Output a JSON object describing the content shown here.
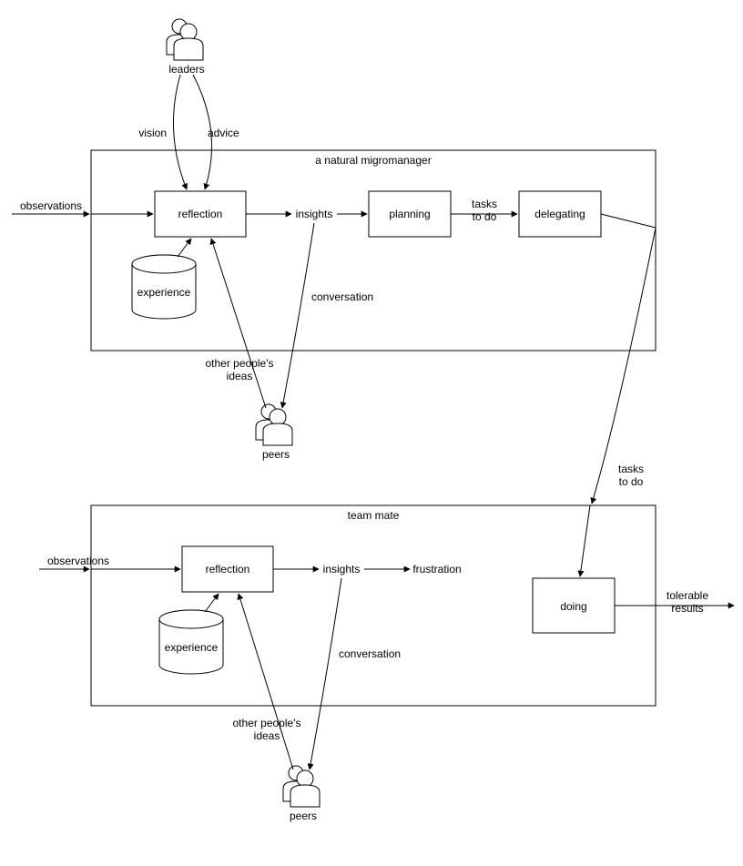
{
  "containers": {
    "top": {
      "title": "a natural migromanager"
    },
    "bottom": {
      "title": "team mate"
    }
  },
  "nodes": {
    "leaders": "leaders",
    "reflection1": "reflection",
    "insights1": "insights",
    "planning": "planning",
    "delegating": "delegating",
    "experience1": "experience",
    "peers1": "peers",
    "reflection2": "reflection",
    "insights2": "insights",
    "frustration": "frustration",
    "doing": "doing",
    "experience2": "experience",
    "peers2": "peers"
  },
  "edges": {
    "observations1": "observations",
    "observations2": "observations",
    "vision": "vision",
    "advice": "advice",
    "conversation1": "conversation",
    "conversation2": "conversation",
    "ideas1_l1": "other people's",
    "ideas1_l2": "ideas",
    "ideas2_l1": "other people's",
    "ideas2_l2": "ideas",
    "tasks1_l1": "tasks",
    "tasks1_l2": "to do",
    "tasks2_l1": "tasks",
    "tasks2_l2": "to do",
    "tolerable_l1": "tolerable",
    "tolerable_l2": "results"
  }
}
